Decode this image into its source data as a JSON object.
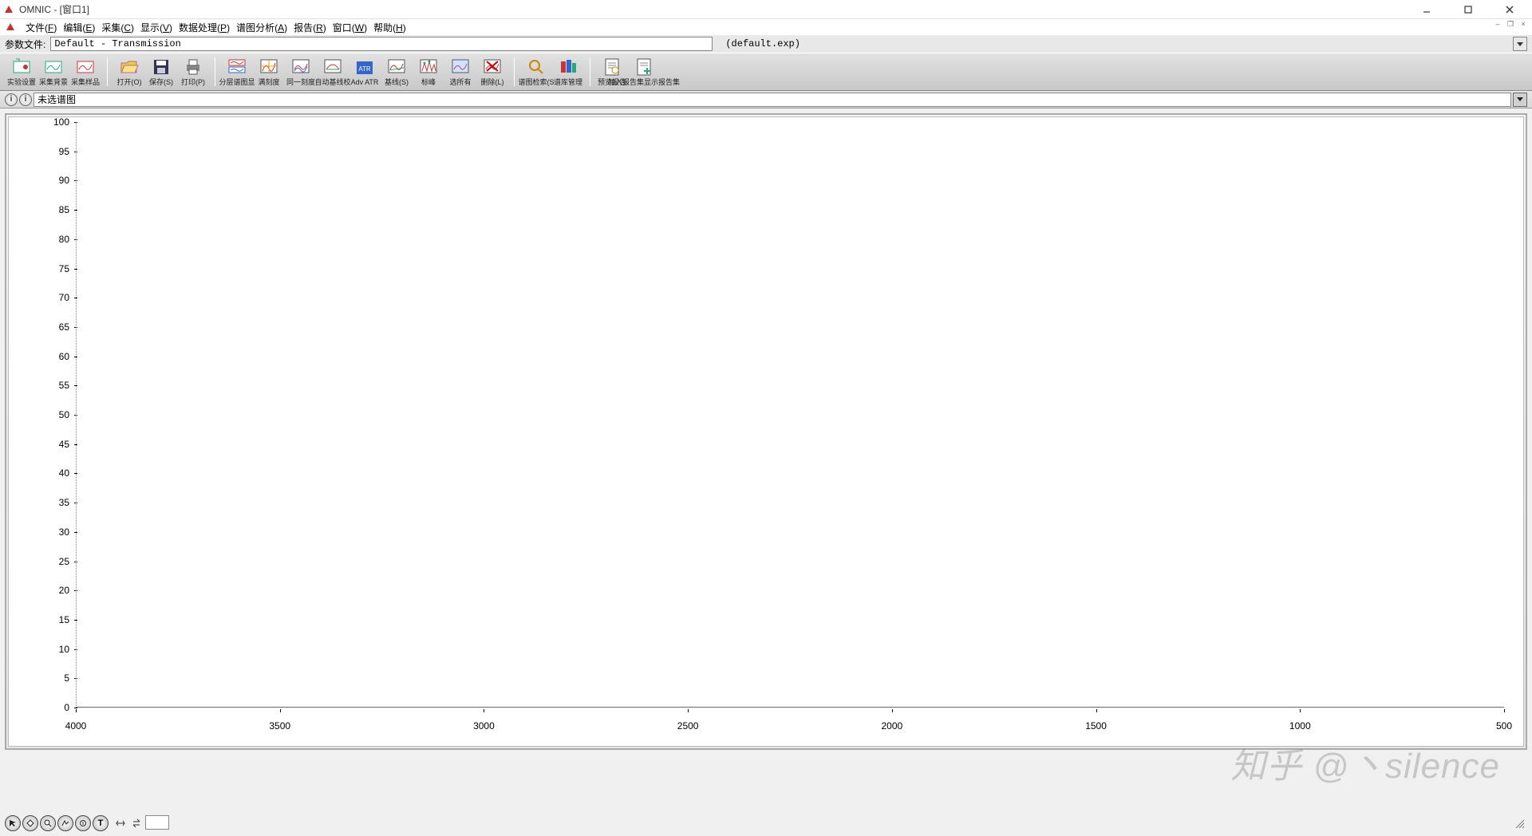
{
  "titlebar": {
    "title": "OMNIC - [窗口1]"
  },
  "menu": {
    "items": [
      {
        "label": "文件",
        "hk": "F"
      },
      {
        "label": "编辑",
        "hk": "E"
      },
      {
        "label": "采集",
        "hk": "C"
      },
      {
        "label": "显示",
        "hk": "V"
      },
      {
        "label": "数据处理",
        "hk": "P"
      },
      {
        "label": "谱图分析",
        "hk": "A"
      },
      {
        "label": "报告",
        "hk": "R"
      },
      {
        "label": "窗口",
        "hk": "W"
      },
      {
        "label": "帮助",
        "hk": "H"
      }
    ]
  },
  "param": {
    "label": "参数文件:",
    "value": "Default - Transmission",
    "exp": "(default.exp)"
  },
  "toolbar": {
    "groups": [
      [
        {
          "name": "experiment-setup",
          "label": "实验设置"
        },
        {
          "name": "collect-background",
          "label": "采集背景"
        },
        {
          "name": "collect-sample",
          "label": "采集样品"
        }
      ],
      [
        {
          "name": "open",
          "label": "打开(O)"
        },
        {
          "name": "save",
          "label": "保存(S)"
        },
        {
          "name": "print",
          "label": "打印(P)"
        }
      ],
      [
        {
          "name": "stacked-overlay",
          "label": "分层谱图显"
        },
        {
          "name": "full-scale",
          "label": "满刻度"
        },
        {
          "name": "common-scale",
          "label": "同一刻度"
        },
        {
          "name": "auto-baseline",
          "label": "自动基线校"
        },
        {
          "name": "adv-atr",
          "label": "Adv ATR"
        },
        {
          "name": "baseline",
          "label": "基线(S)"
        },
        {
          "name": "find-peaks",
          "label": "标峰"
        },
        {
          "name": "select-all",
          "label": "选所有"
        },
        {
          "name": "delete",
          "label": "删除(L)"
        }
      ],
      [
        {
          "name": "library-search",
          "label": "谱图检索(S"
        },
        {
          "name": "library-manage",
          "label": "谱库管理"
        }
      ],
      [
        {
          "name": "preview-report",
          "label": "预览报告"
        },
        {
          "name": "add-report",
          "label": "加入报告集显示报告集"
        }
      ]
    ]
  },
  "spec_title": {
    "value": "未选谱图"
  },
  "chart_data": {
    "type": "line",
    "title": "",
    "xlabel": "",
    "ylabel": "",
    "x_ticks": [
      4000,
      3500,
      3000,
      2500,
      2000,
      1500,
      1000,
      500
    ],
    "y_ticks": [
      0,
      5,
      10,
      15,
      20,
      25,
      30,
      35,
      40,
      45,
      50,
      55,
      60,
      65,
      70,
      75,
      80,
      85,
      90,
      95,
      100
    ],
    "xlim": [
      4000,
      500
    ],
    "ylim": [
      0,
      100
    ],
    "series": []
  },
  "watermark": "知乎 @丶silence"
}
